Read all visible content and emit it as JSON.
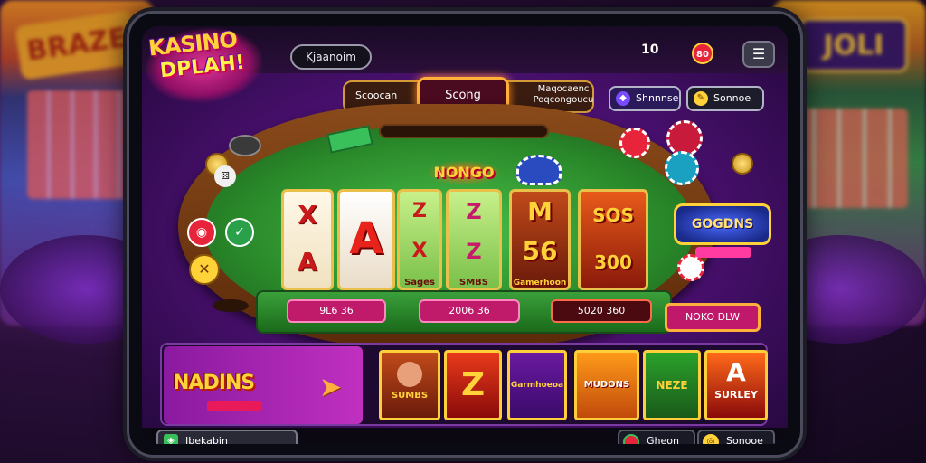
{
  "background": {
    "left_sign": "BRAZE",
    "right_sign": "JOLI"
  },
  "header": {
    "logo_line1": "KASINO",
    "logo_line2": "DPLAH!",
    "title_pill": "Kjaanoim",
    "stat_value": "10",
    "stat_icon": "80",
    "menu_icon": "menu-icon"
  },
  "subbar": {
    "left_label": "Scoocan",
    "center_label": "Scong",
    "right_label": "Maqocaenc Poqcongoucu"
  },
  "top_buttons": {
    "btn_a": "Shnnnse",
    "btn_b": "Sonnoe"
  },
  "table": {
    "bonus_title": "NONGO",
    "reels": {
      "r1_top": "X",
      "r1_bottom": "A",
      "r2_big": "A",
      "r3_top": "Z",
      "r3_mid": "X",
      "r3_bottom": "Sages",
      "r4_top": "Z",
      "r4_mid": "Z",
      "r4_bottom": "SMBS",
      "r5_top": "M",
      "r5_mid": "56",
      "r5_bottom": "Gamerhoon",
      "r6_top": "SOS",
      "r6_mid": "300"
    },
    "goldens": "GOGDNS",
    "bets": {
      "bet1": "9L6 36",
      "bet2": "2006 36",
      "bet3": "5020 360"
    },
    "bet_side": "NOKO DLW"
  },
  "promo": {
    "title": "NADINS",
    "arrow": "➤"
  },
  "game_tiles": {
    "t1": "SUMBS",
    "t2": "Z",
    "t3": "Garmhoeoa",
    "t4": "MUDONS",
    "t5": "NEZE",
    "t6_big": "A",
    "t6_small": "SURLEY"
  },
  "footer": {
    "left_label": "Ibekabin",
    "r1_label": "Gheon",
    "r2_label": "Sonooe"
  },
  "colors": {
    "felt": "#2a8a2a",
    "rim": "#6a3a14",
    "accent_gold": "#ffd23a",
    "pink": "#c01a6a"
  }
}
